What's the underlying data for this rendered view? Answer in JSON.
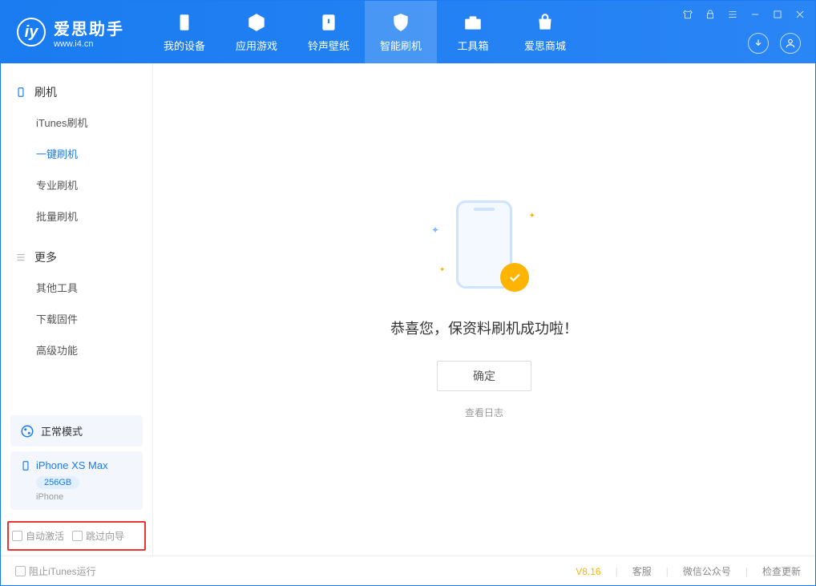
{
  "app": {
    "title": "爱思助手",
    "subtitle": "www.i4.cn"
  },
  "nav": {
    "tabs": [
      {
        "label": "我的设备"
      },
      {
        "label": "应用游戏"
      },
      {
        "label": "铃声壁纸"
      },
      {
        "label": "智能刷机"
      },
      {
        "label": "工具箱"
      },
      {
        "label": "爱思商城"
      }
    ]
  },
  "sidebar": {
    "group1_title": "刷机",
    "group1_items": [
      "iTunes刷机",
      "一键刷机",
      "专业刷机",
      "批量刷机"
    ],
    "group2_title": "更多",
    "group2_items": [
      "其他工具",
      "下载固件",
      "高级功能"
    ],
    "mode": "正常模式",
    "device": {
      "name": "iPhone XS Max",
      "capacity": "256GB",
      "type": "iPhone"
    },
    "checks": {
      "auto_activate": "自动激活",
      "skip_guide": "跳过向导"
    }
  },
  "main": {
    "success_message": "恭喜您，保资料刷机成功啦！",
    "ok_button": "确定",
    "view_log": "查看日志"
  },
  "footer": {
    "block_itunes": "阻止iTunes运行",
    "version": "V8.16",
    "links": [
      "客服",
      "微信公众号",
      "检查更新"
    ]
  }
}
